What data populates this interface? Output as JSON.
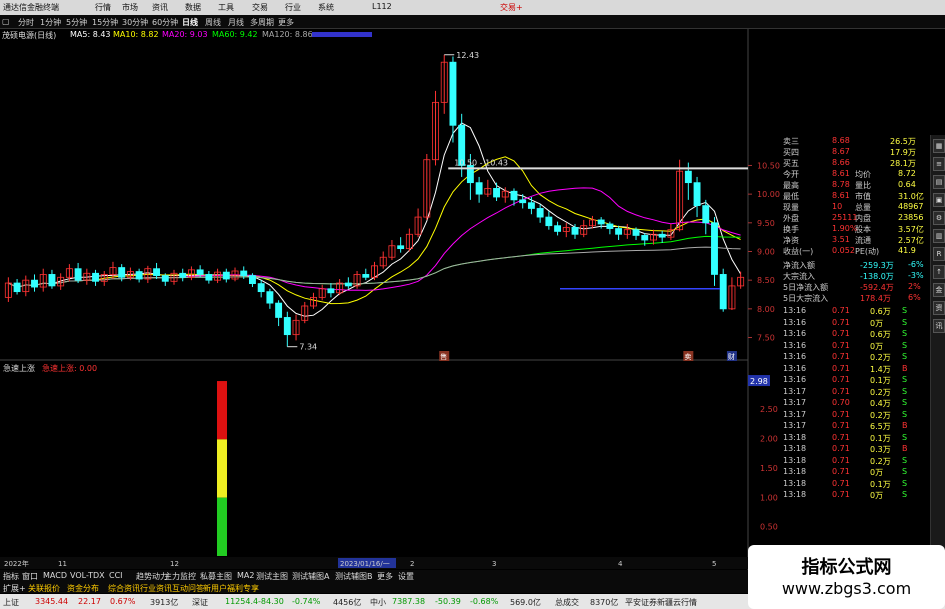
{
  "menubar": {
    "app_title": "通达信金融终端",
    "items": [
      "行情",
      "市场",
      "资讯",
      "数据",
      "工具",
      "交易",
      "行业",
      "系统"
    ],
    "code": "L112",
    "trade": "交易+"
  },
  "periods": [
    "分时",
    "1分钟",
    "5分钟",
    "15分钟",
    "30分钟",
    "60分钟",
    "日线",
    "周线",
    "月线",
    "多周期",
    "更多"
  ],
  "active_period": "日线",
  "indicators": {
    "name": "茂硕电源(日线)",
    "ma5": "MA5: 8.43",
    "ma10": "MA10: 8.82",
    "ma20": "MA20: 9.03",
    "ma60": "MA60: 9.42",
    "ma120": "MA120: 8.86"
  },
  "chart_data": {
    "type": "candlestick",
    "price_axis_ticks": [
      "10.50",
      "10.00",
      "9.50",
      "9.00",
      "8.50",
      "8.00",
      "7.50"
    ],
    "price_range": [
      7.3,
      12.6
    ],
    "annotations": {
      "high": "12.43",
      "low": "7.34",
      "level_label": "10.50 - 10.43"
    },
    "markers": [
      "售",
      "卖",
      "财"
    ],
    "sub_indicator": {
      "name": "急速上涨",
      "label": "急速上涨: 0.00",
      "value_box": "2.98",
      "ticks": [
        "2.50",
        "2.00",
        "1.50",
        "1.00",
        "0.50"
      ],
      "bar_value": 2.98
    },
    "date_labels": [
      "2022年",
      "11",
      "12",
      "2023/01/16/一",
      "2",
      "3",
      "4",
      "5"
    ],
    "candles": [
      [
        8.2,
        8.45,
        8.12,
        8.55
      ],
      [
        8.45,
        8.3,
        8.25,
        8.52
      ],
      [
        8.3,
        8.5,
        8.22,
        8.58
      ],
      [
        8.5,
        8.38,
        8.3,
        8.6
      ],
      [
        8.38,
        8.6,
        8.3,
        8.7
      ],
      [
        8.6,
        8.4,
        8.35,
        8.68
      ],
      [
        8.4,
        8.55,
        8.33,
        8.62
      ],
      [
        8.55,
        8.7,
        8.48,
        8.78
      ],
      [
        8.7,
        8.5,
        8.45,
        8.8
      ],
      [
        8.5,
        8.62,
        8.42,
        8.7
      ],
      [
        8.62,
        8.48,
        8.4,
        8.68
      ],
      [
        8.48,
        8.6,
        8.4,
        8.66
      ],
      [
        8.6,
        8.72,
        8.52,
        8.82
      ],
      [
        8.72,
        8.55,
        8.48,
        8.78
      ],
      [
        8.55,
        8.65,
        8.5,
        8.72
      ],
      [
        8.65,
        8.52,
        8.46,
        8.7
      ],
      [
        8.52,
        8.7,
        8.45,
        8.75
      ],
      [
        8.7,
        8.58,
        8.52,
        8.8
      ],
      [
        8.58,
        8.48,
        8.4,
        8.62
      ],
      [
        8.48,
        8.62,
        8.42,
        8.68
      ],
      [
        8.62,
        8.55,
        8.48,
        8.7
      ],
      [
        8.55,
        8.68,
        8.5,
        8.74
      ],
      [
        8.68,
        8.6,
        8.55,
        8.76
      ],
      [
        8.6,
        8.5,
        8.44,
        8.66
      ],
      [
        8.5,
        8.64,
        8.45,
        8.7
      ],
      [
        8.64,
        8.52,
        8.46,
        8.7
      ],
      [
        8.52,
        8.66,
        8.48,
        8.72
      ],
      [
        8.66,
        8.58,
        8.52,
        8.74
      ],
      [
        8.58,
        8.44,
        8.38,
        8.62
      ],
      [
        8.44,
        8.3,
        8.2,
        8.5
      ],
      [
        8.3,
        8.1,
        8.0,
        8.35
      ],
      [
        8.1,
        7.85,
        7.7,
        8.15
      ],
      [
        7.85,
        7.55,
        7.34,
        7.95
      ],
      [
        7.55,
        7.8,
        7.45,
        7.9
      ],
      [
        7.8,
        8.05,
        7.75,
        8.12
      ],
      [
        8.05,
        8.2,
        8.0,
        8.28
      ],
      [
        8.2,
        8.35,
        8.15,
        8.42
      ],
      [
        8.35,
        8.28,
        8.2,
        8.45
      ],
      [
        8.28,
        8.45,
        8.24,
        8.52
      ],
      [
        8.45,
        8.4,
        8.35,
        8.55
      ],
      [
        8.4,
        8.6,
        8.35,
        8.66
      ],
      [
        8.6,
        8.55,
        8.5,
        8.7
      ],
      [
        8.55,
        8.75,
        8.5,
        8.82
      ],
      [
        8.75,
        8.9,
        8.7,
        9.0
      ],
      [
        8.9,
        9.1,
        8.85,
        9.2
      ],
      [
        9.1,
        9.05,
        8.98,
        9.25
      ],
      [
        9.05,
        9.3,
        9.0,
        9.4
      ],
      [
        9.3,
        9.6,
        9.25,
        9.75
      ],
      [
        9.6,
        10.6,
        9.55,
        10.7
      ],
      [
        10.6,
        11.6,
        10.5,
        11.8
      ],
      [
        11.6,
        12.3,
        11.4,
        12.43
      ],
      [
        12.3,
        11.2,
        10.9,
        12.4
      ],
      [
        11.2,
        10.5,
        10.3,
        11.4
      ],
      [
        10.5,
        10.2,
        9.9,
        10.7
      ],
      [
        10.2,
        10.0,
        9.85,
        10.3
      ],
      [
        10.0,
        10.1,
        9.95,
        10.25
      ],
      [
        10.1,
        9.95,
        9.88,
        10.2
      ],
      [
        9.95,
        10.05,
        9.85,
        10.12
      ],
      [
        10.05,
        9.9,
        9.8,
        10.1
      ],
      [
        9.9,
        9.85,
        9.75,
        10.0
      ],
      [
        9.85,
        9.75,
        9.65,
        9.95
      ],
      [
        9.75,
        9.6,
        9.5,
        9.82
      ],
      [
        9.6,
        9.45,
        9.38,
        9.7
      ],
      [
        9.45,
        9.35,
        9.28,
        9.52
      ],
      [
        9.35,
        9.42,
        9.25,
        9.5
      ],
      [
        9.42,
        9.3,
        9.22,
        9.48
      ],
      [
        9.3,
        9.45,
        9.25,
        9.55
      ],
      [
        9.45,
        9.55,
        9.4,
        9.62
      ],
      [
        9.55,
        9.48,
        9.4,
        9.6
      ],
      [
        9.48,
        9.4,
        9.3,
        9.52
      ],
      [
        9.4,
        9.3,
        9.2,
        9.45
      ],
      [
        9.3,
        9.38,
        9.22,
        9.48
      ],
      [
        9.38,
        9.28,
        9.2,
        9.42
      ],
      [
        9.28,
        9.2,
        9.1,
        9.32
      ],
      [
        9.2,
        9.3,
        9.12,
        9.38
      ],
      [
        9.3,
        9.25,
        9.15,
        9.36
      ],
      [
        9.25,
        9.38,
        9.2,
        9.48
      ],
      [
        9.38,
        10.4,
        9.35,
        10.6
      ],
      [
        10.4,
        10.2,
        9.9,
        10.55
      ],
      [
        10.2,
        9.8,
        9.6,
        10.3
      ],
      [
        9.8,
        9.5,
        9.3,
        9.9
      ],
      [
        9.5,
        8.6,
        8.4,
        9.6
      ],
      [
        8.6,
        8.0,
        7.95,
        8.7
      ],
      [
        8.0,
        8.4,
        7.98,
        8.55
      ],
      [
        8.4,
        8.55,
        8.35,
        8.65
      ]
    ]
  },
  "right_panel": {
    "quote_rows": [
      {
        "label": "卖三",
        "val": "8.68",
        "vol": "26.5万"
      },
      {
        "label": "买四",
        "val": "8.67",
        "vol": "17.9万"
      },
      {
        "label": "买五",
        "val": "8.66",
        "vol": "28.1万"
      },
      {
        "label": "今开",
        "val": "8.61",
        "label2": "均价",
        "val2": "8.72"
      },
      {
        "label": "最高",
        "val": "8.78",
        "label2": "量比",
        "val2": "0.64"
      },
      {
        "label": "最低",
        "val": "8.61",
        "label2": "市值",
        "val2": "31.0亿"
      },
      {
        "label": "现量",
        "val": "10",
        "label2": "总量",
        "val2": "48967"
      },
      {
        "label": "外盘",
        "val": "25111",
        "label2": "内盘",
        "val2": "23856"
      },
      {
        "label": "换手",
        "val": "1.90%",
        "label2": "股本",
        "val2": "3.57亿"
      },
      {
        "label": "净资",
        "val": "3.51",
        "label2": "流通",
        "val2": "2.57亿"
      },
      {
        "label": "收益(一)",
        "val": "0.052",
        "label2": "PE(动)",
        "val2": "41.9"
      }
    ],
    "flow_rows": [
      {
        "label": "净流入额",
        "val": "-259.3万",
        "pct": "-6%"
      },
      {
        "label": "大宗流入",
        "val": "-138.0万",
        "pct": "-3%"
      },
      {
        "label": "5日净流入额",
        "val": "-592.4万",
        "pct": "2%"
      },
      {
        "label": "5日大宗流入",
        "val": "178.4万",
        "pct": "6%"
      }
    ],
    "ticks": [
      {
        "t": "13:16",
        "p": "0.71",
        "v": "0.6万",
        "s": "S"
      },
      {
        "t": "13:16",
        "p": "0.71",
        "v": "0万",
        "s": "S"
      },
      {
        "t": "13:16",
        "p": "0.71",
        "v": "0.6万",
        "s": "S"
      },
      {
        "t": "13:16",
        "p": "0.71",
        "v": "0万",
        "s": "S"
      },
      {
        "t": "13:16",
        "p": "0.71",
        "v": "0.2万",
        "s": "S"
      },
      {
        "t": "13:16",
        "p": "0.71",
        "v": "1.4万",
        "s": "B"
      },
      {
        "t": "13:16",
        "p": "0.71",
        "v": "0.1万",
        "s": "S"
      },
      {
        "t": "13:17",
        "p": "0.71",
        "v": "0.2万",
        "s": "S"
      },
      {
        "t": "13:17",
        "p": "0.70",
        "v": "0.4万",
        "s": "S"
      },
      {
        "t": "13:17",
        "p": "0.71",
        "v": "0.2万",
        "s": "S"
      },
      {
        "t": "13:17",
        "p": "0.71",
        "v": "6.5万",
        "s": "B"
      },
      {
        "t": "13:18",
        "p": "0.71",
        "v": "0.1万",
        "s": "S"
      },
      {
        "t": "13:18",
        "p": "0.71",
        "v": "0.3万",
        "s": "B"
      },
      {
        "t": "13:18",
        "p": "0.71",
        "v": "0.2万",
        "s": "S"
      },
      {
        "t": "13:18",
        "p": "0.71",
        "v": "0万",
        "s": "S"
      },
      {
        "t": "13:18",
        "p": "0.71",
        "v": "0.1万",
        "s": "S"
      },
      {
        "t": "13:18",
        "p": "0.71",
        "v": "0万",
        "s": "S"
      }
    ]
  },
  "tabs": [
    "指标",
    "窗口",
    "MACD",
    "VOL-TDX",
    "CCI",
    "趋势动力",
    "主力监控",
    "私募主图",
    "MA2",
    "测试主图",
    "测试辅图A",
    "测试辅图B",
    "更多",
    "设置"
  ],
  "subtabs": [
    "扩展+",
    "关联报价",
    "资金分布",
    "综合资讯",
    "行业资讯",
    "互动问答",
    "新用户福利专享"
  ],
  "status": [
    {
      "label": "上证",
      "v1": "3345.44",
      "v2": "22.17",
      "v3": "0.67%",
      "v4": "3913亿"
    },
    {
      "label": "深证",
      "v1": "11254.4",
      "v2": "-84.30",
      "v3": "-0.74%",
      "v4": "4456亿"
    },
    {
      "label": "中小",
      "v1": "7387.38",
      "v2": "-50.39",
      "v3": "-0.68%",
      "v4": "569.0亿"
    },
    {
      "label": "总成交",
      "v1": "8370亿",
      "v2": "",
      "v3": "",
      "v4": ""
    }
  ],
  "status_right": "平安证券新疆云行情",
  "watermark": {
    "line1": "指标公式网",
    "line2": "www.zbgs3.com"
  },
  "colors": {
    "up": "#ff3333",
    "down": "#33ffff",
    "ma5": "#ffffff",
    "ma10": "#ffff00",
    "ma20": "#ff00ff",
    "ma60": "#00ff00",
    "ma120": "#aaaaaa"
  }
}
